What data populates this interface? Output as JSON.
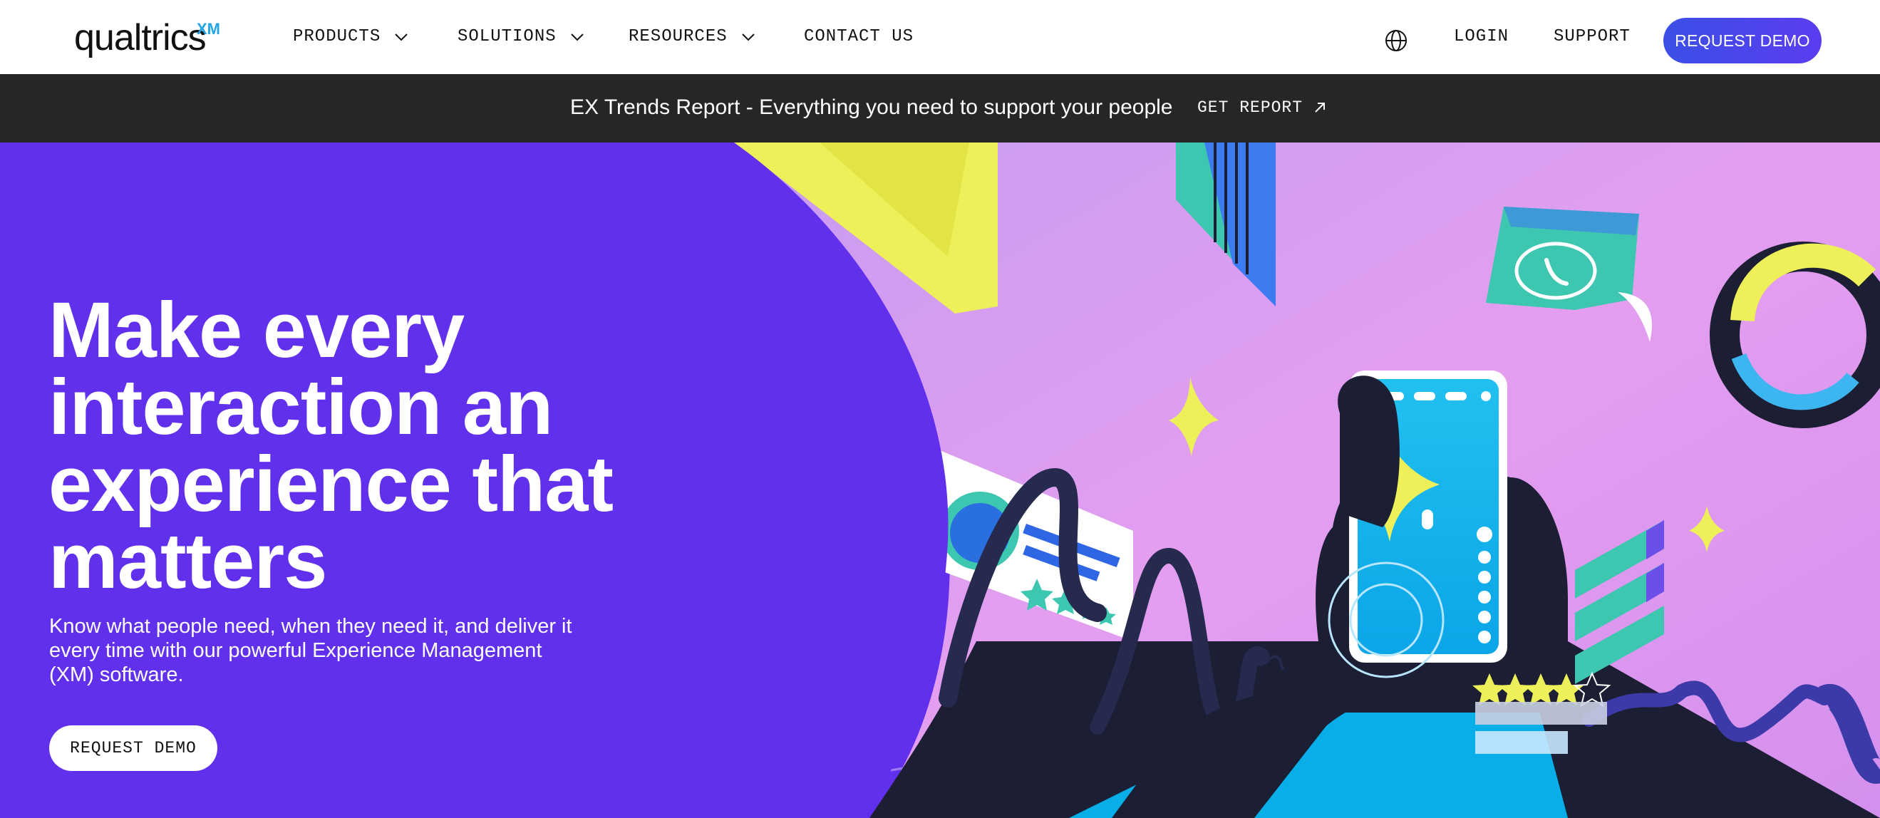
{
  "nav": {
    "logo_text": "qualtrics",
    "logo_mark": "XM",
    "items": [
      {
        "label": "PRODUCTS",
        "icon": "chevron-down-icon"
      },
      {
        "label": "SOLUTIONS",
        "icon": "chevron-down-icon"
      },
      {
        "label": "RESOURCES",
        "icon": "chevron-down-icon"
      },
      {
        "label": "CONTACT US"
      }
    ],
    "globe_icon": "globe-icon",
    "login": "LOGIN",
    "support": "SUPPORT",
    "request_demo": "REQUEST DEMO"
  },
  "announcement": {
    "text": "EX Trends Report - Everything you need to support your people",
    "cta": "GET REPORT",
    "cta_icon": "arrow-up-right-icon"
  },
  "hero": {
    "headline": "Make every interaction an experience that matters",
    "subhead": "Know what people need, when they need it, and deliver it every time with our powerful Experience Management (XM) software.",
    "cta": "REQUEST DEMO",
    "rating_stars_filled": 4,
    "rating_stars_total": 5
  },
  "colors": {
    "hero_purple": "#6130ec",
    "accent_blue": "#3b4fe6",
    "announce_bg": "#262626",
    "logo_accent": "#21a4e8"
  }
}
